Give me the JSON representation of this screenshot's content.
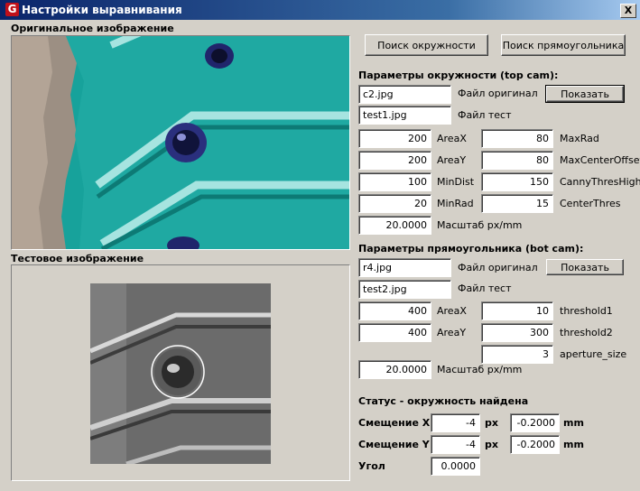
{
  "window": {
    "app_icon": "G",
    "title": "Настройки выравнивания",
    "close_label": "X"
  },
  "images": {
    "original_label": "Оригинальное изображение",
    "test_label": "Тестовое изображение"
  },
  "top_buttons": {
    "find_circle": "Поиск окружности",
    "find_rect": "Поиск прямоугольника"
  },
  "circle_params": {
    "heading": "Параметры окружности (top cam):",
    "file_original": "c2.jpg",
    "file_original_label": "Файл оригинал",
    "show_button": "Показать",
    "file_test": "test1.jpg",
    "file_test_label": "Файл тест",
    "areax": "200",
    "areax_label": "AreaX",
    "areay": "200",
    "areay_label": "AreaY",
    "mindist": "100",
    "mindist_label": "MinDist",
    "minrad": "20",
    "minrad_label": "MinRad",
    "maxrad": "80",
    "maxrad_label": "MaxRad",
    "maxcenteroffset": "80",
    "maxcenteroffset_label": "MaxCenterOffset",
    "cannythreshigh": "150",
    "cannythreshigh_label": "CannyThresHigh",
    "centerthres": "15",
    "centerthres_label": "CenterThres",
    "scale": "20.0000",
    "scale_label": "Масштаб px/mm"
  },
  "rect_params": {
    "heading": "Параметры прямоугольника (bot cam):",
    "file_original": "r4.jpg",
    "file_original_label": "Файл оригинал",
    "show_button": "Показать",
    "file_test": "test2.jpg",
    "file_test_label": "Файл тест",
    "areax": "400",
    "areax_label": "AreaX",
    "areay": "400",
    "areay_label": "AreaY",
    "threshold1": "10",
    "threshold1_label": "threshold1",
    "threshold2": "300",
    "threshold2_label": "threshold2",
    "aperture_size": "3",
    "aperture_size_label": "aperture_size",
    "scale": "20.0000",
    "scale_label": "Масштаб px/mm"
  },
  "status": {
    "text": "Статус - окружность найдена",
    "offset_x_label": "Смещение X",
    "offset_x_px": "-4",
    "px_unit": "px",
    "offset_x_mm": "-0.2000",
    "mm_unit": "mm",
    "offset_y_label": "Смещение Y",
    "offset_y_px": "-4",
    "offset_y_mm": "-0.2000",
    "angle_label": "Угол",
    "angle": "0.0000"
  },
  "colors": {
    "window_bg": "#d4d0c8",
    "title_bg": "#0a246a",
    "pcb_teal": "#19a39c"
  }
}
